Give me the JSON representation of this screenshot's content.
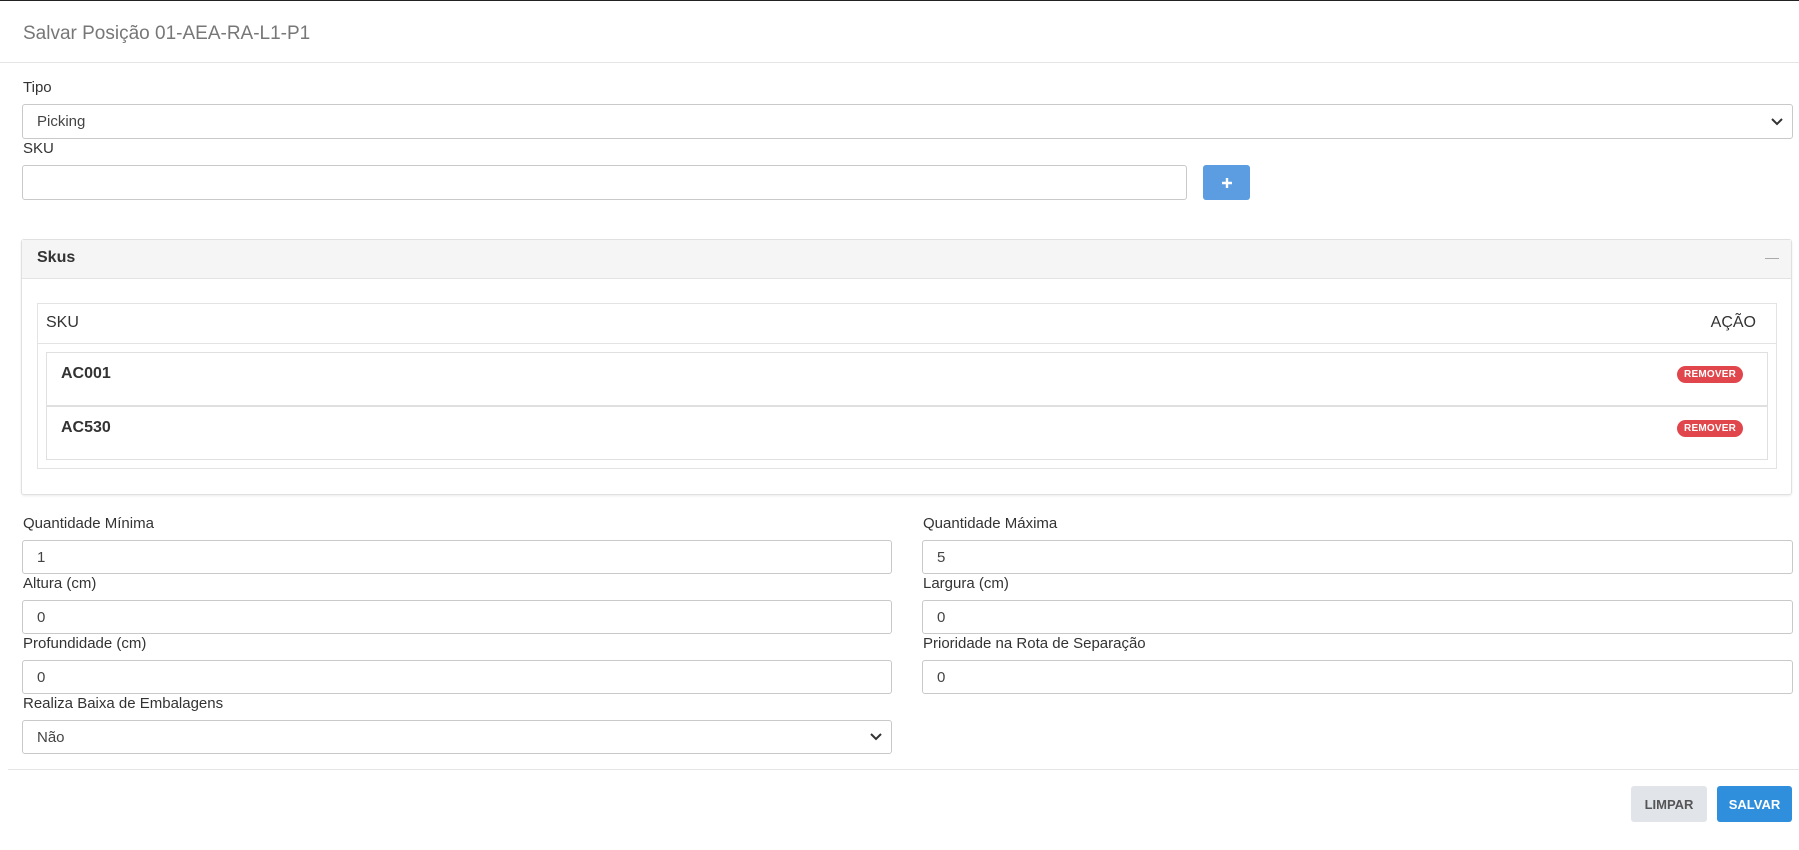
{
  "modal": {
    "title": "Salvar Posição 01-AEA-RA-L1-P1"
  },
  "form": {
    "tipo": {
      "label": "Tipo",
      "value": "Picking"
    },
    "sku": {
      "label": "SKU",
      "value": "",
      "add_icon": "plus-icon"
    },
    "skus_panel": {
      "title": "Skus",
      "columns": [
        "SKU",
        "AÇÃO"
      ],
      "rows": [
        {
          "sku": "AC001",
          "action": "REMOVER"
        },
        {
          "sku": "AC530",
          "action": "REMOVER"
        }
      ]
    },
    "quantidade_minima": {
      "label": "Quantidade Mínima",
      "value": "1"
    },
    "quantidade_maxima": {
      "label": "Quantidade Máxima",
      "value": "5"
    },
    "altura": {
      "label": "Altura (cm)",
      "value": "0"
    },
    "largura": {
      "label": "Largura (cm)",
      "value": "0"
    },
    "profundidade": {
      "label": "Profundidade (cm)",
      "value": "0"
    },
    "prioridade": {
      "label": "Prioridade na Rota de Separação",
      "value": "0"
    },
    "baixa_embalagens": {
      "label": "Realiza Baixa de Embalagens",
      "value": "Não"
    }
  },
  "footer": {
    "limpar_label": "LIMPAR",
    "salvar_label": "SALVAR"
  },
  "colors": {
    "primary": "#2f8fdd",
    "add_button": "#5c9ce0",
    "danger": "#e0464b"
  }
}
